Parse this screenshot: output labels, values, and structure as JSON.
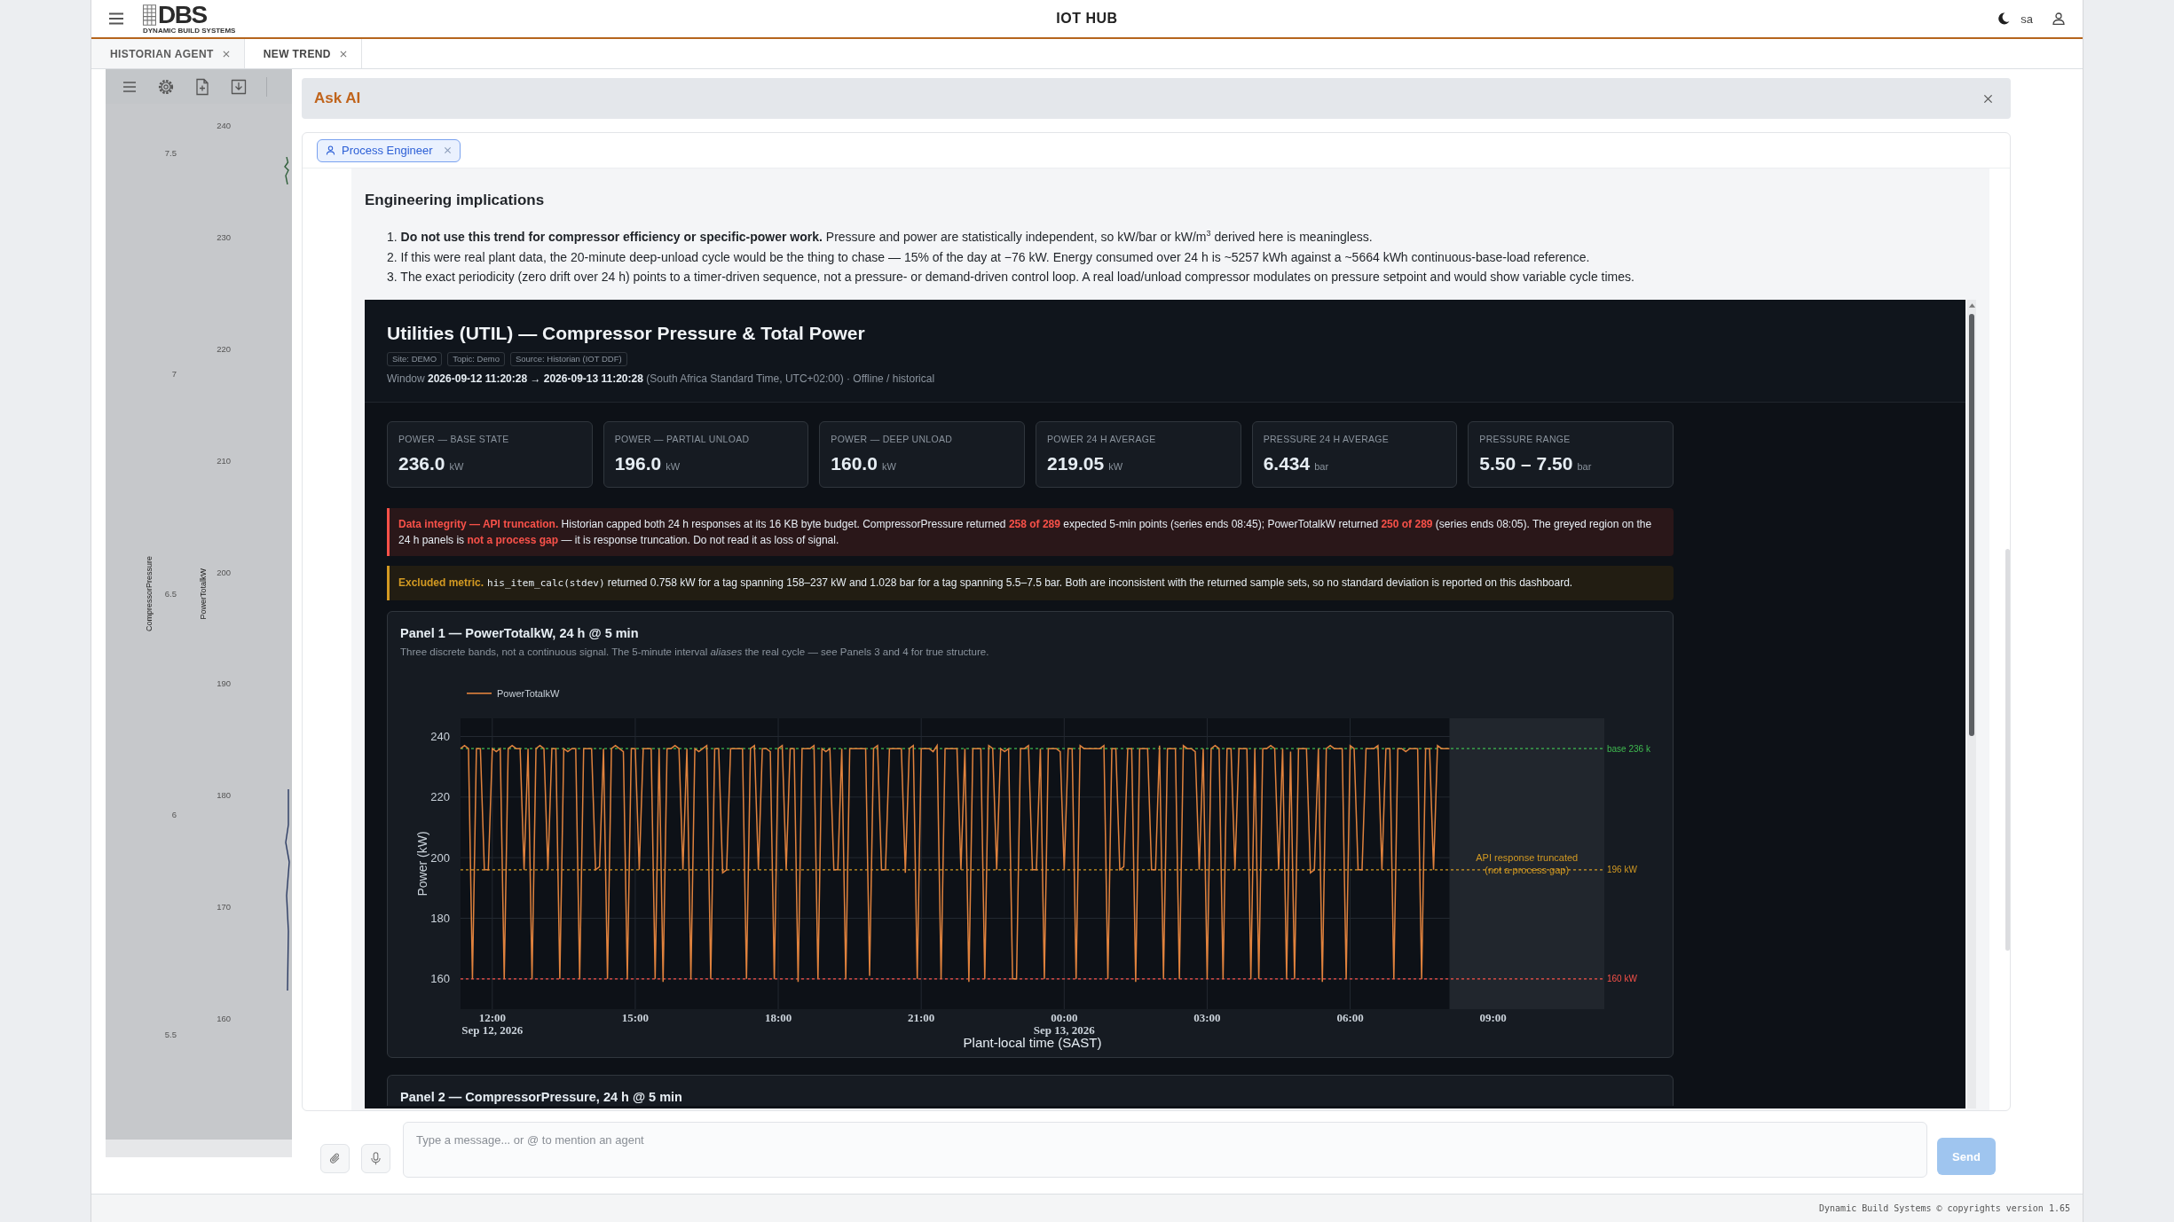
{
  "app_bar": {
    "logo": {
      "mark": "DBS",
      "tagline": "DYNAMIC BUILD SYSTEMS"
    },
    "title": "IOT HUB",
    "user": "sa"
  },
  "tabs": [
    {
      "label": "HISTORIAN AGENT",
      "selected": false
    },
    {
      "label": "NEW TREND",
      "selected": true
    }
  ],
  "trend_panel": {
    "axes": [
      {
        "title": "CompressorPressure",
        "ticks": [
          "7.5",
          "7",
          "6.5",
          "6",
          "5.5"
        ]
      },
      {
        "title": "PowerTotalkW",
        "ticks": [
          "240",
          "230",
          "220",
          "210",
          "200",
          "190",
          "180",
          "170",
          "160"
        ]
      }
    ]
  },
  "dialog": {
    "title": "Ask AI",
    "agent_chip": {
      "label": "Process Engineer"
    },
    "message": {
      "heading": "Engineering implications",
      "items": [
        {
          "number": "1.",
          "text": "**Do not use this trend for compressor efficiency or specific-power work.** Pressure and power are statistically independent, so kW/bar or kW/m$^{3}$ derived here is meaningless."
        },
        {
          "number": "2.",
          "text": "If this were real plant data, the 20-minute deep-unload cycle would be the thing to chase — 15% of the day at −76 kW. Energy consumed over 24 h is ~5257 kWh against a ~5664 kWh continuous-base-load reference."
        },
        {
          "number": "3.",
          "text": "The exact periodicity (zero drift over 24 h) points to a timer-driven sequence, not a pressure- or demand-driven control loop. A real load/unload compressor modulates on pressure setpoint and would show variable cycle times."
        }
      ],
      "dashboard": {
        "title": "Utilities (UTIL) — Compressor Pressure & Total Power",
        "tags": [
          "Site: DEMO",
          "Topic: Demo",
          "Source: Historian (IOT DDF)"
        ],
        "window": "Window **2026-09-12 11:20:28 → 2026-09-13 11:20:28** (South Africa Standard Time, UTC+02:00) · Offline / historical",
        "kpis": [
          {
            "label": "POWER — BASE STATE",
            "value": "236.0",
            "unit": "kW"
          },
          {
            "label": "POWER — PARTIAL UNLOAD",
            "value": "196.0",
            "unit": "kW"
          },
          {
            "label": "POWER — DEEP UNLOAD",
            "value": "160.0",
            "unit": "kW"
          },
          {
            "label": "POWER 24 H AVERAGE",
            "value": "219.05",
            "unit": "kW"
          },
          {
            "label": "PRESSURE 24 H AVERAGE",
            "value": "6.434",
            "unit": "bar"
          },
          {
            "label": "PRESSURE RANGE",
            "value": "5.50 – 7.50",
            "unit": "bar"
          }
        ],
        "alerts": [
          {
            "kind": "danger",
            "segments": [
              {
                "kind": "label",
                "text": "Data integrity — API truncation."
              },
              {
                "kind": "text",
                "text": " Historian capped both 24 h responses at its 16 KB byte budget. CompressorPressure returned "
              },
              {
                "kind": "highlight",
                "text": "258 of 289"
              },
              {
                "kind": "text",
                "text": " expected 5-min points (series ends 08:45); PowerTotalkW returned "
              },
              {
                "kind": "highlight",
                "text": "250 of 289"
              },
              {
                "kind": "text",
                "text": " (series ends 08:05). The greyed region on the 24 h panels is "
              },
              {
                "kind": "highlight",
                "text": "not a process gap"
              },
              {
                "kind": "text",
                "text": " — it is response truncation. Do not read it as loss of signal."
              }
            ]
          },
          {
            "kind": "warning",
            "segments": [
              {
                "kind": "label",
                "text": "Excluded metric."
              },
              {
                "kind": "code",
                "text": "his_item_calc(stdev)"
              },
              {
                "kind": "text",
                "text": " returned 0.758 kW for a tag spanning 158–237 kW and 1.028 bar for a tag spanning 5.5–7.5 bar. Both are inconsistent with the returned sample sets, so no standard deviation is reported on this dashboard."
              }
            ]
          }
        ],
        "panels": [
          {
            "title": "Panel 1 — PowerTotalkW, 24 h @ 5 min",
            "subtitle": "Three discrete bands, not a continuous signal. The 5-minute interval *aliases* the real cycle — see Panels 3 and 4 for true structure.",
            "chart_data": {
              "type": "line",
              "xlabel": "Plant-local time (SAST)",
              "ylabel": "Power (kW)",
              "categories": [
                null,
                null,
                null,
                null,
                null,
                null,
                null,
                null,
                "12:00\nSep 12, 2026",
                null,
                null,
                null,
                null,
                null,
                null,
                null,
                null,
                null,
                null,
                null,
                null,
                null,
                null,
                null,
                null,
                null,
                null,
                null,
                null,
                null,
                null,
                null,
                null,
                null,
                null,
                null,
                null,
                null,
                null,
                null,
                null,
                null,
                null,
                null,
                "15:00",
                null,
                null,
                null,
                null,
                null,
                null,
                null,
                null,
                null,
                null,
                null,
                null,
                null,
                null,
                null,
                null,
                null,
                null,
                null,
                null,
                null,
                null,
                null,
                null,
                null,
                null,
                null,
                null,
                null,
                null,
                null,
                null,
                null,
                null,
                null,
                "18:00",
                null,
                null,
                null,
                null,
                null,
                null,
                null,
                null,
                null,
                null,
                null,
                null,
                null,
                null,
                null,
                null,
                null,
                null,
                null,
                null,
                null,
                null,
                null,
                null,
                null,
                null,
                null,
                null,
                null,
                null,
                null,
                null,
                null,
                null,
                null,
                "21:00",
                null,
                null,
                null,
                null,
                null,
                null,
                null,
                null,
                null,
                null,
                null,
                null,
                null,
                null,
                null,
                null,
                null,
                null,
                null,
                null,
                null,
                null,
                null,
                null,
                null,
                null,
                null,
                null,
                null,
                null,
                null,
                null,
                null,
                null,
                null,
                "00:00\nSep 13, 2026",
                null,
                null,
                null,
                null,
                null,
                null,
                null,
                null,
                null,
                null,
                null,
                null,
                null,
                null,
                null,
                null,
                null,
                null,
                null,
                null,
                null,
                null,
                null,
                null,
                null,
                null,
                null,
                null,
                null,
                null,
                null,
                null,
                null,
                null,
                null,
                "03:00",
                null,
                null,
                null,
                null,
                null,
                null,
                null,
                null,
                null,
                null,
                null,
                null,
                null,
                null,
                null,
                null,
                null,
                null,
                null,
                null,
                null,
                null,
                null,
                null,
                null,
                null,
                null,
                null,
                null,
                null,
                null,
                null,
                null,
                null,
                null,
                "06:00",
                null,
                null,
                null,
                null,
                null,
                null,
                null,
                null,
                null,
                null,
                null,
                null,
                null,
                null,
                null,
                null,
                null,
                null,
                null,
                null,
                null,
                null,
                null,
                null,
                null,
                null,
                null,
                null,
                null,
                null,
                null,
                null,
                null,
                null,
                null,
                "09:00",
                null,
                null,
                null,
                null,
                null,
                null,
                null,
                null,
                null,
                null,
                null,
                null,
                null,
                null,
                null,
                null,
                null,
                null,
                null,
                null,
                null,
                null,
                null,
                null,
                null,
                null,
                null,
                null
              ],
              "series": [
                {
                  "name": "PowerTotalkW",
                  "color": "#e0823d",
                  "values": [
                    236,
                    237,
                    236,
                    160,
                    236,
                    236,
                    196,
                    196,
                    236,
                    235,
                    236,
                    160,
                    236,
                    237,
                    236,
                    236,
                    196,
                    236,
                    160,
                    236,
                    237,
                    236,
                    196,
                    236,
                    236,
                    160,
                    236,
                    235,
                    236,
                    236,
                    160,
                    236,
                    236,
                    236,
                    196,
                    197,
                    236,
                    160,
                    236,
                    237,
                    236,
                    235,
                    160,
                    236,
                    236,
                    196,
                    236,
                    236,
                    236,
                    160,
                    236,
                    159,
                    236,
                    236,
                    237,
                    236,
                    196,
                    236,
                    160,
                    236,
                    235,
                    236,
                    237,
                    160,
                    236,
                    236,
                    195,
                    196,
                    236,
                    236,
                    236,
                    236,
                    160,
                    236,
                    237,
                    196,
                    236,
                    236,
                    235,
                    160,
                    236,
                    237,
                    196,
                    236,
                    236,
                    159,
                    236,
                    236,
                    236,
                    237,
                    160,
                    236,
                    235,
                    236,
                    196,
                    196,
                    236,
                    160,
                    236,
                    236,
                    236,
                    236,
                    236,
                    161,
                    236,
                    237,
                    196,
                    196,
                    236,
                    236,
                    236,
                    236,
                    195,
                    236,
                    237,
                    160,
                    236,
                    236,
                    236,
                    235,
                    237,
                    160,
                    236,
                    236,
                    236,
                    236,
                    196,
                    236,
                    159,
                    236,
                    236,
                    236,
                    160,
                    237,
                    236,
                    196,
                    236,
                    235,
                    236,
                    160,
                    160,
                    236,
                    236,
                    237,
                    196,
                    196,
                    236,
                    160,
                    236,
                    236,
                    236,
                    235,
                    196,
                    236,
                    236,
                    160,
                    237,
                    236,
                    236,
                    236,
                    236,
                    236,
                    237,
                    160,
                    236,
                    236,
                    196,
                    197,
                    236,
                    236,
                    159,
                    236,
                    236,
                    236,
                    196,
                    196,
                    237,
                    160,
                    236,
                    236,
                    236,
                    160,
                    237,
                    236,
                    236,
                    235,
                    196,
                    236,
                    160,
                    236,
                    237,
                    236,
                    160,
                    236,
                    236,
                    196,
                    236,
                    236,
                    236,
                    160,
                    236,
                    160,
                    236,
                    236,
                    237,
                    236,
                    196,
                    236,
                    160,
                    235,
                    160,
                    236,
                    236,
                    236,
                    195,
                    196,
                    236,
                    159,
                    236,
                    237,
                    236,
                    236,
                    236,
                    160,
                    237,
                    236,
                    196,
                    196,
                    236,
                    236,
                    236,
                    237,
                    196,
                    236,
                    236,
                    160,
                    236,
                    236,
                    235,
                    236,
                    236,
                    236,
                    160,
                    236,
                    236,
                    196,
                    237,
                    236,
                    236,
                    236,
                    null,
                    null,
                    null,
                    null,
                    null,
                    null,
                    null,
                    null,
                    null,
                    null,
                    null,
                    null,
                    null,
                    null,
                    null,
                    null,
                    null,
                    null,
                    null,
                    null,
                    null,
                    null,
                    null,
                    null,
                    null,
                    null,
                    null,
                    null,
                    null,
                    null,
                    null,
                    null,
                    null,
                    null,
                    null,
                    null,
                    null,
                    null,
                    null
                  ]
                }
              ],
              "ylim": [
                150,
                246
              ],
              "yticks": [
                160,
                180,
                200,
                220,
                240
              ],
              "grid": true,
              "ref_lines": [
                {
                  "axis": "y",
                  "value": 236,
                  "label": "base 236 k",
                  "color": "#3fb950"
                },
                {
                  "axis": "y",
                  "value": 196,
                  "label": "196 kW",
                  "color": "#d29922"
                },
                {
                  "axis": "y",
                  "value": 160,
                  "label": "160 kW",
                  "color": "#f85149"
                }
              ],
              "annotations": [
                "API response truncated\n(not a process gap)"
              ]
            }
          },
          {
            "title": "Panel 2 — CompressorPressure, 24 h @ 5 min"
          }
        ]
      }
    },
    "composer": {
      "placeholder": "Type a message... or @ to mention an agent",
      "send": {
        "label": "Send",
        "disabled": true
      }
    }
  },
  "footer": {
    "text": "Dynamic Build Systems © copyrights version 1.65"
  }
}
